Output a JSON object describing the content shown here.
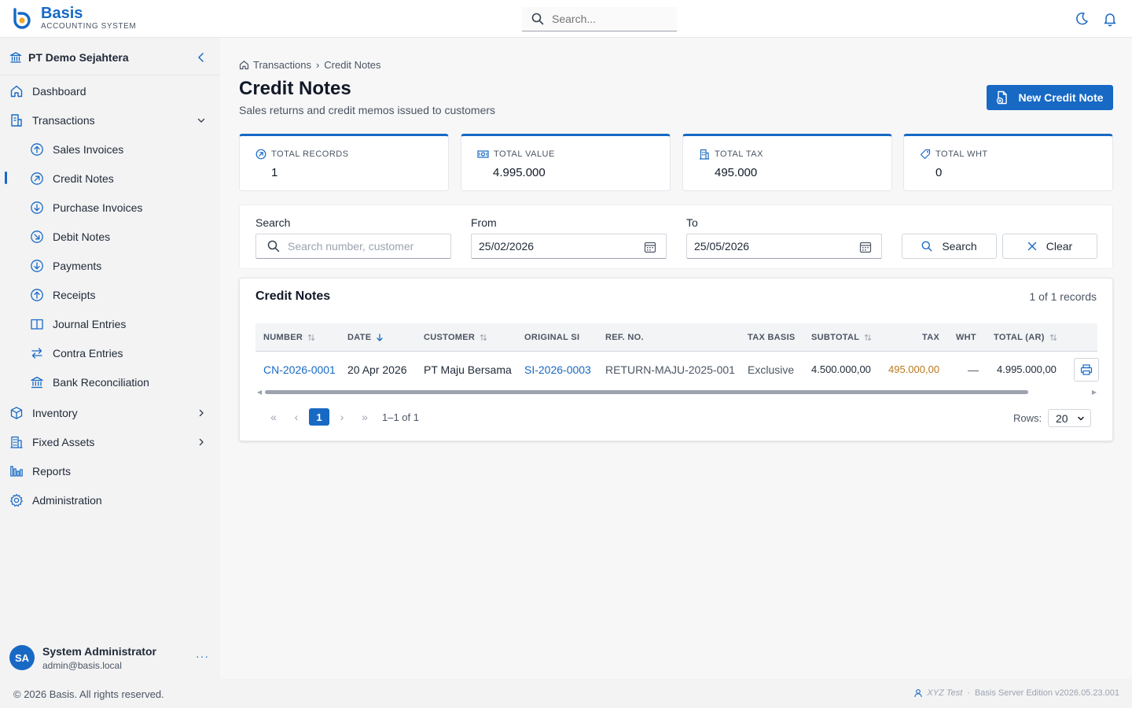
{
  "brand": {
    "name": "Basis",
    "subtitle": "ACCOUNTING SYSTEM"
  },
  "header": {
    "search_placeholder": "Search...",
    "icons": [
      "moon-icon",
      "bell-icon"
    ]
  },
  "sidebar": {
    "company": "PT Demo Sejahtera",
    "items": [
      {
        "label": "Dashboard",
        "icon": "home-icon"
      },
      {
        "label": "Transactions",
        "icon": "document-icon",
        "expanded": true
      },
      {
        "label": "Sales Invoices",
        "icon": "arrow-up-circle-icon"
      },
      {
        "label": "Credit Notes",
        "icon": "arrow-up-right-circle-icon",
        "active": true
      },
      {
        "label": "Purchase Invoices",
        "icon": "arrow-down-circle-icon"
      },
      {
        "label": "Debit Notes",
        "icon": "arrow-down-right-circle-icon"
      },
      {
        "label": "Payments",
        "icon": "arrow-down-circle-icon"
      },
      {
        "label": "Receipts",
        "icon": "arrow-up-circle-icon"
      },
      {
        "label": "Journal Entries",
        "icon": "book-icon"
      },
      {
        "label": "Contra Entries",
        "icon": "swap-icon"
      },
      {
        "label": "Bank Reconciliation",
        "icon": "bank-icon"
      },
      {
        "label": "Inventory",
        "icon": "box-icon"
      },
      {
        "label": "Fixed Assets",
        "icon": "building-icon"
      },
      {
        "label": "Reports",
        "icon": "bar-chart-icon"
      },
      {
        "label": "Administration",
        "icon": "gear-icon"
      }
    ],
    "user": {
      "initials": "SA",
      "name": "System Administrator",
      "email": "admin@basis.local",
      "more": "···"
    }
  },
  "breadcrumb": {
    "parent": "Transactions",
    "sep": "›",
    "current": "Credit Notes"
  },
  "page": {
    "title": "Credit Notes",
    "subtitle": "Sales returns and credit memos issued to customers",
    "new_button": "New Credit Note"
  },
  "stats": [
    {
      "label": "TOTAL RECORDS",
      "value": "1"
    },
    {
      "label": "TOTAL VALUE",
      "value": "4.995.000"
    },
    {
      "label": "TOTAL TAX",
      "value": "495.000"
    },
    {
      "label": "TOTAL WHT",
      "value": "0"
    }
  ],
  "filters": {
    "search_label": "Search",
    "search_placeholder": "Search number, customer",
    "from_label": "From",
    "from_value": "25/02/2026",
    "to_label": "To",
    "to_value": "25/05/2026",
    "search_button": "Search",
    "clear_button": "Clear"
  },
  "table": {
    "title": "Credit Notes",
    "count": "1 of 1 records",
    "columns": [
      "NUMBER",
      "DATE",
      "CUSTOMER",
      "ORIGINAL SI",
      "REF. NO.",
      "TAX BASIS",
      "SUBTOTAL",
      "TAX",
      "WHT",
      "TOTAL (AR)"
    ],
    "rows": [
      {
        "number": "CN-2026-0001",
        "date": "20 Apr 2026",
        "customer": "PT Maju Bersama",
        "original_si": "SI-2026-0003",
        "ref_no": "RETURN-MAJU-2025-001",
        "tax_basis": "Exclusive",
        "subtotal": "4.500.000,00",
        "tax": "495.000,00",
        "wht": "—",
        "total": "4.995.000,00"
      }
    ]
  },
  "pagination": {
    "first": "«",
    "prev": "‹",
    "current": "1",
    "next": "›",
    "last": "»",
    "info": "1–1 of 1",
    "rows_label": "Rows:",
    "rows_value": "20"
  },
  "footer": {
    "copyright": "© 2026 Basis. All rights reserved.",
    "tenant": "XYZ Test",
    "sep": "·",
    "version": "Basis Server Edition v2026.05.23.001"
  },
  "colors": {
    "accent": "#1769c4",
    "tax": "#b7791f"
  }
}
